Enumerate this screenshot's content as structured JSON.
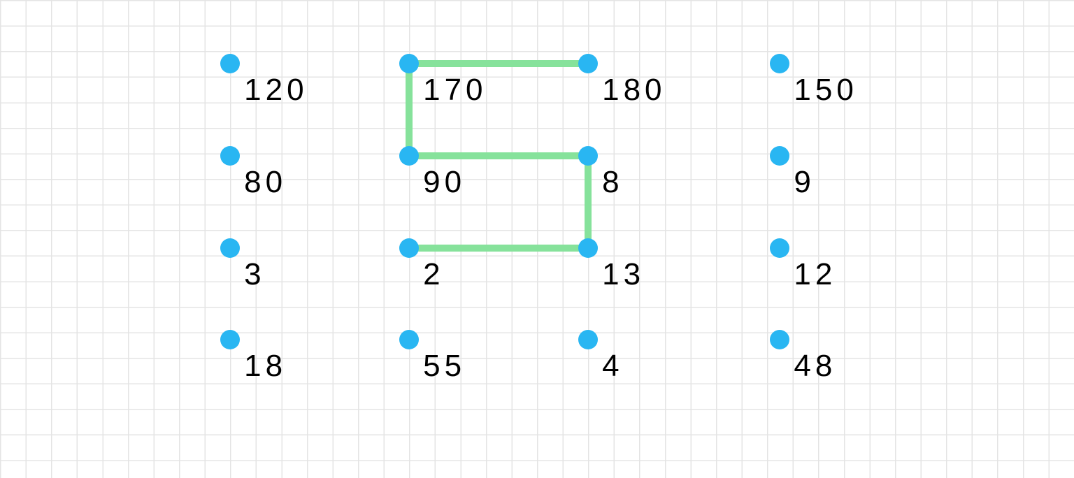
{
  "cellSize": 36.57,
  "dotColor": "#29b6f2",
  "lineColor": "#86e29b",
  "nodes": [
    {
      "id": "r0c0",
      "col": 9,
      "row": 2.5,
      "label": "120"
    },
    {
      "id": "r0c1",
      "col": 16,
      "row": 2.5,
      "label": "170"
    },
    {
      "id": "r0c2",
      "col": 23,
      "row": 2.5,
      "label": "180"
    },
    {
      "id": "r0c3",
      "col": 30.5,
      "row": 2.5,
      "label": "150"
    },
    {
      "id": "r1c0",
      "col": 9,
      "row": 6.1,
      "label": "80"
    },
    {
      "id": "r1c1",
      "col": 16,
      "row": 6.1,
      "label": "90"
    },
    {
      "id": "r1c2",
      "col": 23,
      "row": 6.1,
      "label": "8"
    },
    {
      "id": "r1c3",
      "col": 30.5,
      "row": 6.1,
      "label": "9"
    },
    {
      "id": "r2c0",
      "col": 9,
      "row": 9.7,
      "label": "3"
    },
    {
      "id": "r2c1",
      "col": 16,
      "row": 9.7,
      "label": "2"
    },
    {
      "id": "r2c2",
      "col": 23,
      "row": 9.7,
      "label": "13"
    },
    {
      "id": "r2c3",
      "col": 30.5,
      "row": 9.7,
      "label": "12"
    },
    {
      "id": "r3c0",
      "col": 9,
      "row": 13.3,
      "label": "18"
    },
    {
      "id": "r3c1",
      "col": 16,
      "row": 13.3,
      "label": "55"
    },
    {
      "id": "r3c2",
      "col": 23,
      "row": 13.3,
      "label": "4"
    },
    {
      "id": "r3c3",
      "col": 30.5,
      "row": 13.3,
      "label": "48"
    }
  ],
  "segments": [
    {
      "from": "r0c1",
      "to": "r0c2"
    },
    {
      "from": "r0c1",
      "to": "r1c1"
    },
    {
      "from": "r1c1",
      "to": "r1c2"
    },
    {
      "from": "r1c2",
      "to": "r2c2"
    },
    {
      "from": "r2c1",
      "to": "r2c2"
    }
  ],
  "accent": {
    "grid": "#e4e4e4",
    "line": "#86e29b",
    "dot": "#29b6f2",
    "text": "#000000"
  }
}
